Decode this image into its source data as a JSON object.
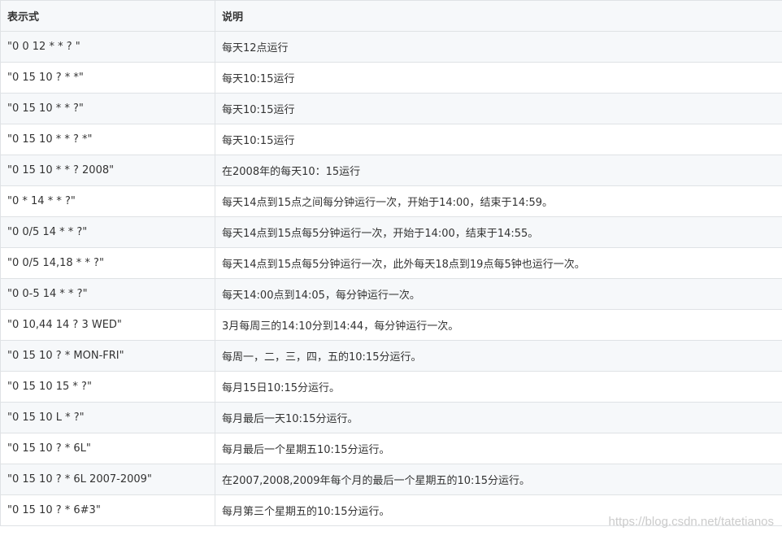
{
  "table": {
    "headers": [
      "表示式",
      "说明"
    ],
    "rows": [
      [
        "\"0 0 12 * * ? \"",
        "每天12点运行"
      ],
      [
        "\"0 15 10 ? * *\"",
        "每天10:15运行"
      ],
      [
        "\"0 15 10 * * ?\"",
        "每天10:15运行"
      ],
      [
        "\"0 15 10 * * ? *\"",
        "每天10:15运行"
      ],
      [
        "\"0 15 10 * * ? 2008\"",
        "在2008年的每天10：15运行"
      ],
      [
        "\"0 * 14 * * ?\"",
        "每天14点到15点之间每分钟运行一次，开始于14:00，结束于14:59。"
      ],
      [
        "\"0 0/5 14 * * ?\"",
        "每天14点到15点每5分钟运行一次，开始于14:00，结束于14:55。"
      ],
      [
        "\"0 0/5 14,18 * * ?\"",
        "每天14点到15点每5分钟运行一次，此外每天18点到19点每5钟也运行一次。"
      ],
      [
        "\"0 0-5 14 * * ?\"",
        "每天14:00点到14:05，每分钟运行一次。"
      ],
      [
        "\"0 10,44 14 ? 3 WED\"",
        "3月每周三的14:10分到14:44，每分钟运行一次。"
      ],
      [
        "\"0 15 10 ? * MON-FRI\"",
        "每周一，二，三，四，五的10:15分运行。"
      ],
      [
        "\"0 15 10 15 * ?\"",
        "每月15日10:15分运行。"
      ],
      [
        "\"0 15 10 L * ?\"",
        "每月最后一天10:15分运行。"
      ],
      [
        "\"0 15 10 ? * 6L\"",
        "每月最后一个星期五10:15分运行。"
      ],
      [
        "\"0 15 10 ? * 6L 2007-2009\"",
        "在2007,2008,2009年每个月的最后一个星期五的10:15分运行。"
      ],
      [
        "\"0 15 10 ? * 6#3\"",
        "每月第三个星期五的10:15分运行。"
      ]
    ]
  },
  "watermark": "https://blog.csdn.net/tatetianos",
  "colors": {
    "border": "#dfe2e5",
    "stripe": "#f6f8fa",
    "text": "#333333"
  }
}
